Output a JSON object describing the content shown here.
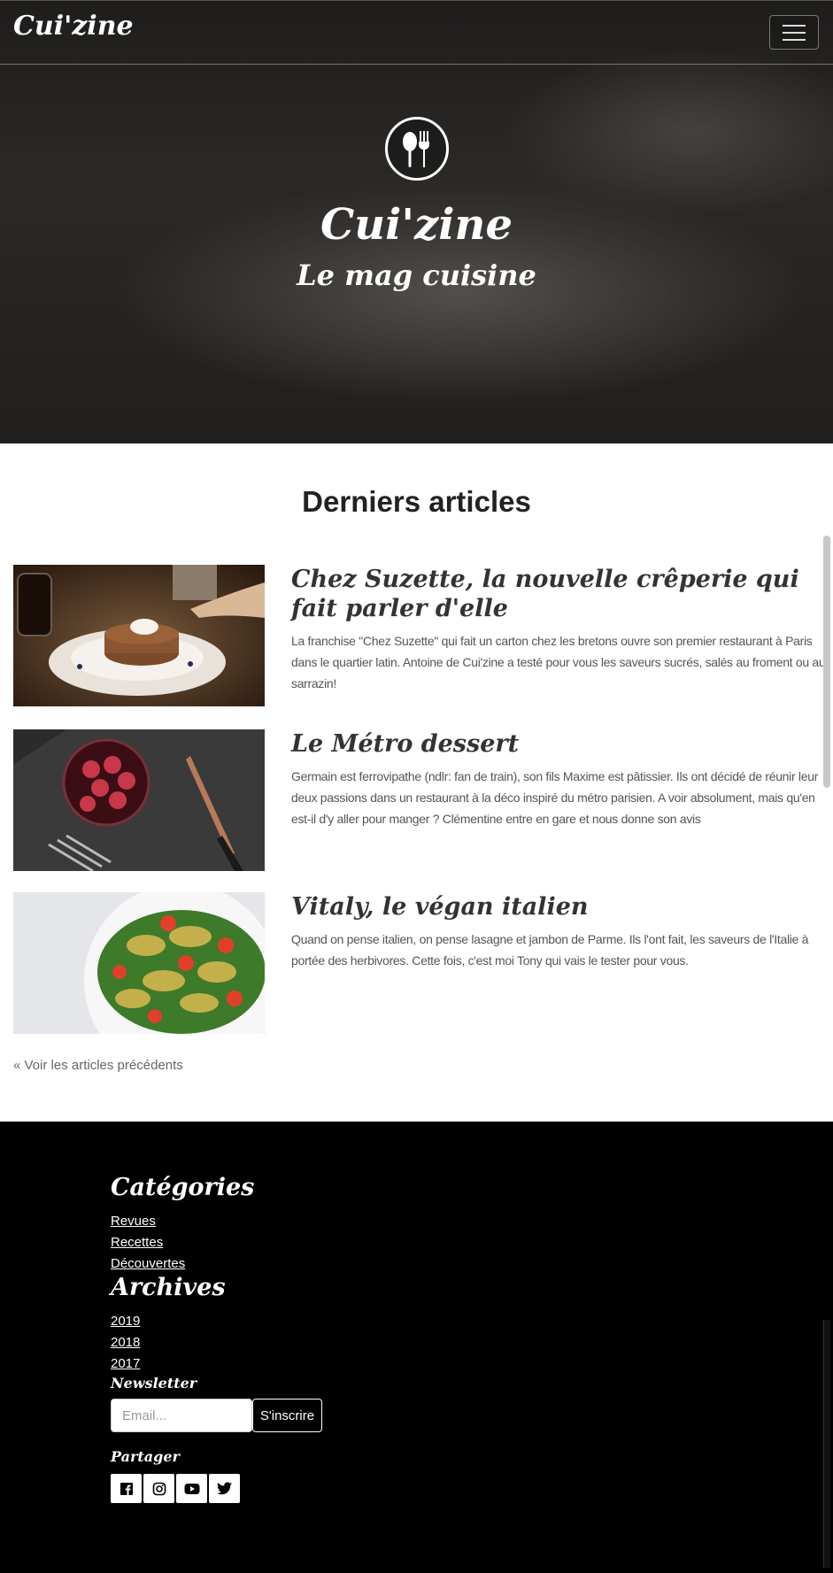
{
  "navbar": {
    "brand": "Cui'zine",
    "toggle_icon": "hamburger-icon"
  },
  "hero": {
    "logo_icon": "spoon-fork-icon",
    "title": "Cui'zine",
    "subtitle": "Le mag cuisine"
  },
  "articles_section": {
    "title": "Derniers articles",
    "articles": [
      {
        "title": "Chez Suzette, la nouvelle crêperie qui fait parler d'elle",
        "text": "La franchise \"Chez Suzette\" qui fait un carton chez les bretons ouvre son premier restaurant à Paris dans le quartier latin. Antoine de Cui'zine a testé pour vous les saveurs sucrés, salés au froment ou au sarrazin!"
      },
      {
        "title": "Le Métro dessert",
        "text": "Germain est ferrovipathe (ndlr: fan de train), son fils Maxime est pâtissier. Ils ont décidé de réunir leur deux passions dans un restaurant à la déco inspiré du métro parisien. A voir absolument, mais qu'en est-il d'y aller pour manger ? Clémentine entre en gare et nous donne son avis"
      },
      {
        "title": "Vitaly, le végan italien",
        "text": "Quand on pense italien, on pense lasagne et jambon de Parme. Ils l'ont fait, les saveurs de l'Italie à portée des herbivores. Cette fois, c'est moi Tony qui vais le tester pour vous."
      }
    ],
    "prev_link": "« Voir les articles précédents"
  },
  "footer": {
    "categories_title": "Catégories",
    "categories": [
      "Revues",
      "Recettes",
      "Découvertes"
    ],
    "archives_title": "Archives",
    "archives": [
      "2019",
      "2018",
      "2017"
    ],
    "newsletter_title": "Newsletter",
    "email_placeholder": "Email...",
    "subscribe_label": "S'inscrire",
    "share_title": "Partager",
    "social_icons": [
      "facebook-icon",
      "instagram-icon",
      "youtube-icon",
      "twitter-icon"
    ]
  }
}
